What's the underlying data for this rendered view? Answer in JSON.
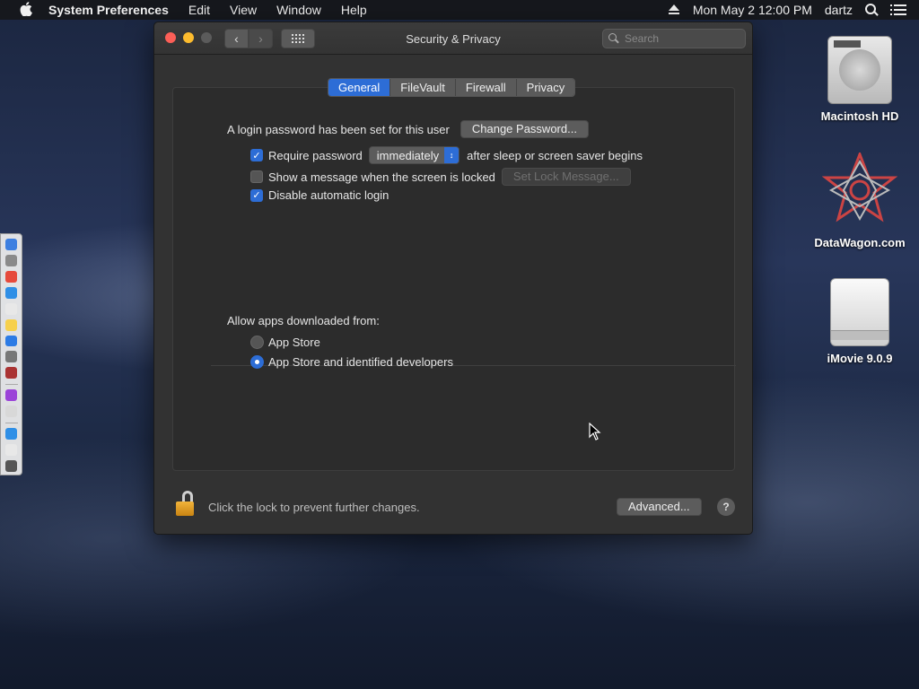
{
  "menubar": {
    "app_name": "System Preferences",
    "menus": [
      "Edit",
      "View",
      "Window",
      "Help"
    ],
    "clock": "Mon May 2  12:00 PM",
    "user": "dartz"
  },
  "window": {
    "title": "Security & Privacy",
    "search_placeholder": "Search"
  },
  "tabs": [
    "General",
    "FileVault",
    "Firewall",
    "Privacy"
  ],
  "general": {
    "login_password_text": "A login password has been set for this user",
    "change_password_label": "Change Password...",
    "require_password_label": "Require password",
    "require_password_value": "immediately",
    "require_password_suffix": "after sleep or screen saver begins",
    "show_message_label": "Show a message when the screen is locked",
    "set_lock_message_label": "Set Lock Message...",
    "disable_login_label": "Disable automatic login",
    "allow_apps_label": "Allow apps downloaded from:",
    "option_app_store": "App Store",
    "option_identified": "App Store and identified developers"
  },
  "footer": {
    "lock_text": "Click the lock to prevent further changes.",
    "advanced_label": "Advanced...",
    "help_label": "?"
  },
  "desktop": {
    "items": [
      "Macintosh HD",
      "DataWagon.com",
      "iMovie 9.0.9"
    ]
  },
  "dock_colors": [
    "#3d7fe0",
    "#8a8a8a",
    "#e64a3c",
    "#2f8fe6",
    "#e8e8e8",
    "#f6d04d",
    "#2c7be5",
    "#777",
    "#a33",
    "#9b44d8",
    "#d8d8d8",
    "#2f8fe6",
    "#e8e8e8",
    "#555"
  ]
}
